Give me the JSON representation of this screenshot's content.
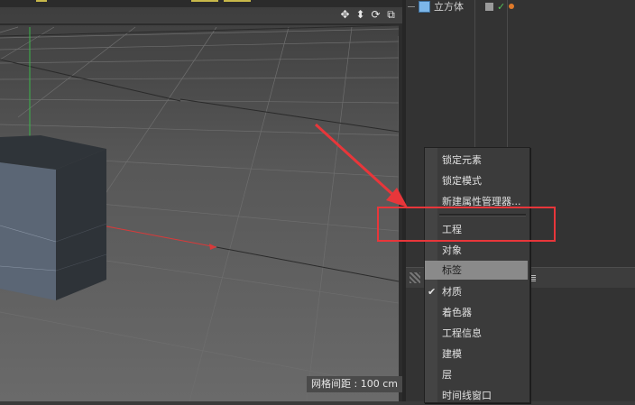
{
  "viewport": {
    "grid_spacing_label": "网格间距 : 100 cm",
    "nav_icons": [
      "move-view-icon",
      "pan-view-icon",
      "rotate-view-icon",
      "maximize-view-icon"
    ],
    "nav_glyphs": [
      "✥",
      "⬍",
      "⟳",
      "⧉"
    ]
  },
  "object_manager": {
    "object_name": "立方体"
  },
  "context_menu": {
    "items": [
      {
        "label": "锁定元素"
      },
      {
        "label": "锁定模式"
      },
      {
        "label": "新建属性管理器..."
      },
      {
        "label": "工程"
      },
      {
        "label": "对象"
      },
      {
        "label": "标签"
      },
      {
        "label": "材质"
      },
      {
        "label": "着色器"
      },
      {
        "label": "工程信息"
      },
      {
        "label": "建模"
      },
      {
        "label": "层"
      },
      {
        "label": "时间线窗口"
      }
    ],
    "checked_item": "材质",
    "selected_item": "标签",
    "check_glyph": "✔"
  },
  "annotation": {
    "highlight_color": "#e8363a",
    "highlighted_item": "工程"
  },
  "colors": {
    "y_axis": "#3bb54a",
    "x_axis": "#d83a3a",
    "cube_front": "#5b6675",
    "cube_side": "#2e3338"
  }
}
